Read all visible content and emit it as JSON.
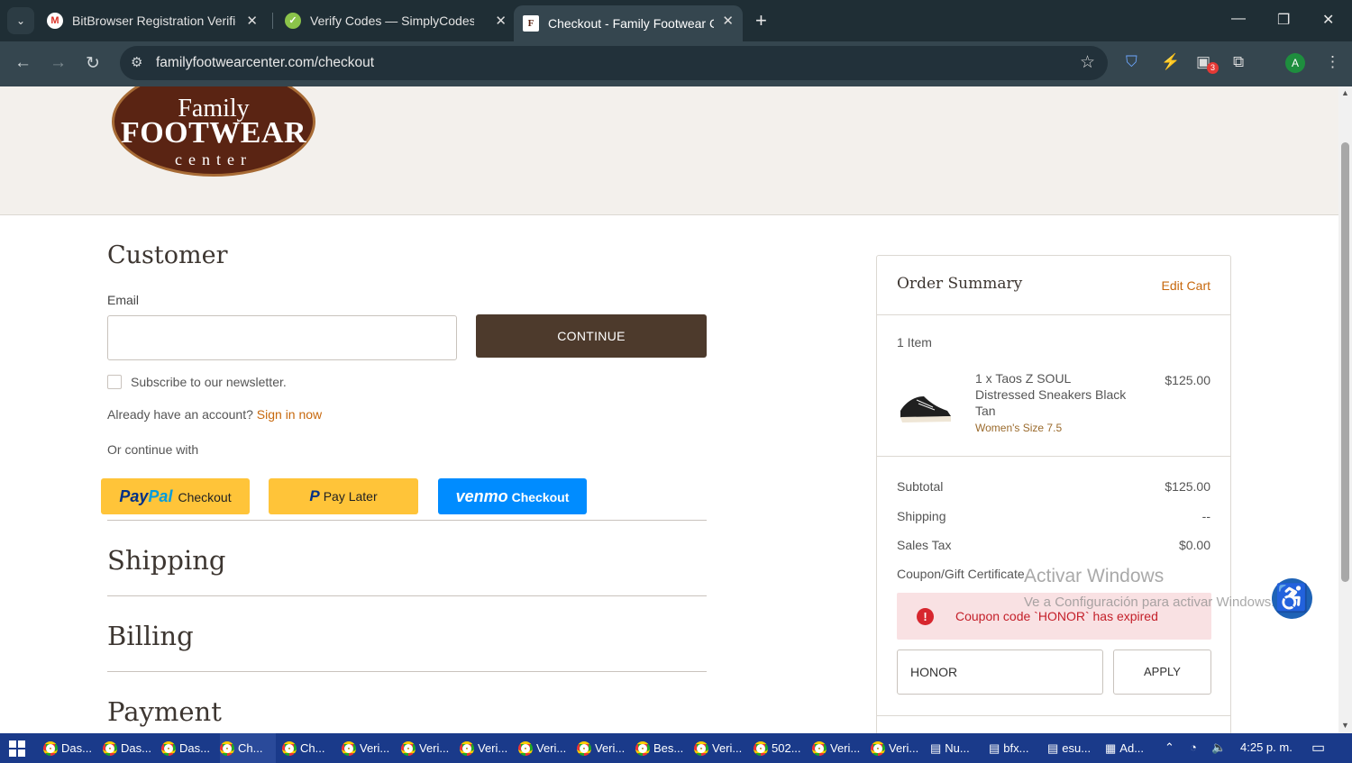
{
  "browser": {
    "tabs": [
      {
        "title": "BitBrowser Registration Verificat",
        "favicon": "gmail-icon",
        "active": false
      },
      {
        "title": "Verify Codes — SimplyCodes",
        "favicon": "simplycodes-icon",
        "active": false
      },
      {
        "title": "Checkout - Family Footwear Cen",
        "favicon": "family-footwear-icon",
        "active": true
      }
    ],
    "url": "familyfootwearcenter.com/checkout",
    "profile_initial": "A",
    "extension_badge": "3"
  },
  "logo": {
    "line1": "Family",
    "line2": "FOOTWEAR",
    "line3": "center"
  },
  "checkout": {
    "customer_title": "Customer",
    "email_label": "Email",
    "email_value": "",
    "continue_label": "CONTINUE",
    "newsletter_label": "Subscribe to our newsletter.",
    "account_prompt": "Already have an account?",
    "sign_in_link": "Sign in now",
    "or_continue": "Or continue with",
    "paypal": {
      "brand_pay": "Pay",
      "brand_pal": "Pal",
      "label": "Checkout"
    },
    "paylater": {
      "label": "Pay Later"
    },
    "venmo": {
      "brand": "venmo",
      "label": "Checkout"
    },
    "shipping_title": "Shipping",
    "billing_title": "Billing",
    "payment_title": "Payment"
  },
  "summary": {
    "title": "Order Summary",
    "edit_cart": "Edit Cart",
    "item_count": "1 Item",
    "item": {
      "name": "1 x Taos Z SOUL Distressed Sneakers Black Tan",
      "option": "Women's Size 7.5",
      "price": "$125.00"
    },
    "subtotal_label": "Subtotal",
    "subtotal_value": "$125.00",
    "shipping_label": "Shipping",
    "shipping_value": "--",
    "tax_label": "Sales Tax",
    "tax_value": "$0.00",
    "coupon_link": "Coupon/Gift Certificate",
    "error_message": "Coupon code `HONOR` has expired",
    "coupon_value": "HONOR",
    "apply_label": "APPLY"
  },
  "watermark": {
    "line1": "Activar Windows",
    "line2": "Ve a Configuración para activar Windows."
  },
  "taskbar": {
    "items": [
      "Das...",
      "Das...",
      "Das...",
      "Ch...",
      "Ch...",
      "Veri...",
      "Veri...",
      "Veri...",
      "Veri...",
      "Veri...",
      "Bes...",
      "Veri...",
      "502...",
      "Veri...",
      "Veri...",
      "Nu...",
      "bfx...",
      "esu...",
      "Ad..."
    ],
    "time": "4:25 p. m."
  }
}
